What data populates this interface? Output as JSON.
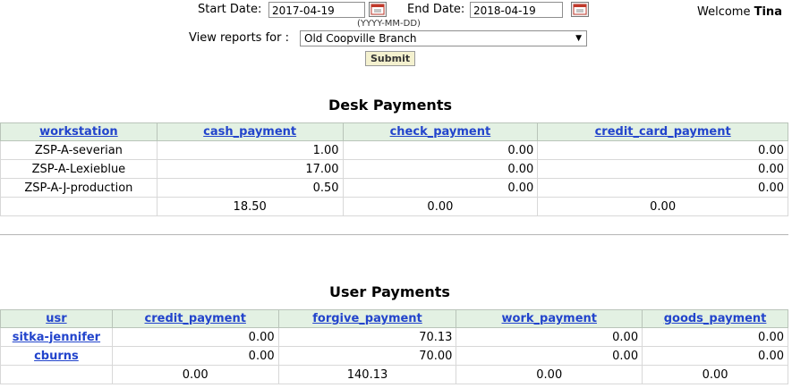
{
  "filters": {
    "start_label": "Start Date:",
    "start_value": "2017-04-19",
    "end_label": "End Date:",
    "end_value": "2018-04-19",
    "format_hint": "(YYYY-MM-DD)",
    "view_label": "View reports for :",
    "branch_value": "Old Coopville Branch",
    "submit_label": "Submit"
  },
  "welcome": {
    "prefix": "Welcome",
    "user": "Tina"
  },
  "desk": {
    "title": "Desk Payments",
    "headers": [
      "workstation",
      "cash_payment",
      "check_payment",
      "credit_card_payment"
    ],
    "rows": [
      [
        "ZSP-A-severian",
        "1.00",
        "0.00",
        "0.00"
      ],
      [
        "ZSP-A-Lexieblue",
        "17.00",
        "0.00",
        "0.00"
      ],
      [
        "ZSP-A-J-production",
        "0.50",
        "0.00",
        "0.00"
      ]
    ],
    "totals": [
      "",
      "18.50",
      "0.00",
      "0.00"
    ]
  },
  "user": {
    "title": "User Payments",
    "headers": [
      "usr",
      "credit_payment",
      "forgive_payment",
      "work_payment",
      "goods_payment"
    ],
    "rows": [
      [
        "sitka-jennifer",
        "0.00",
        "70.13",
        "0.00",
        "0.00"
      ],
      [
        "cburns",
        "0.00",
        "70.00",
        "0.00",
        "0.00"
      ]
    ],
    "totals": [
      "",
      "0.00",
      "140.13",
      "0.00",
      "0.00"
    ]
  }
}
